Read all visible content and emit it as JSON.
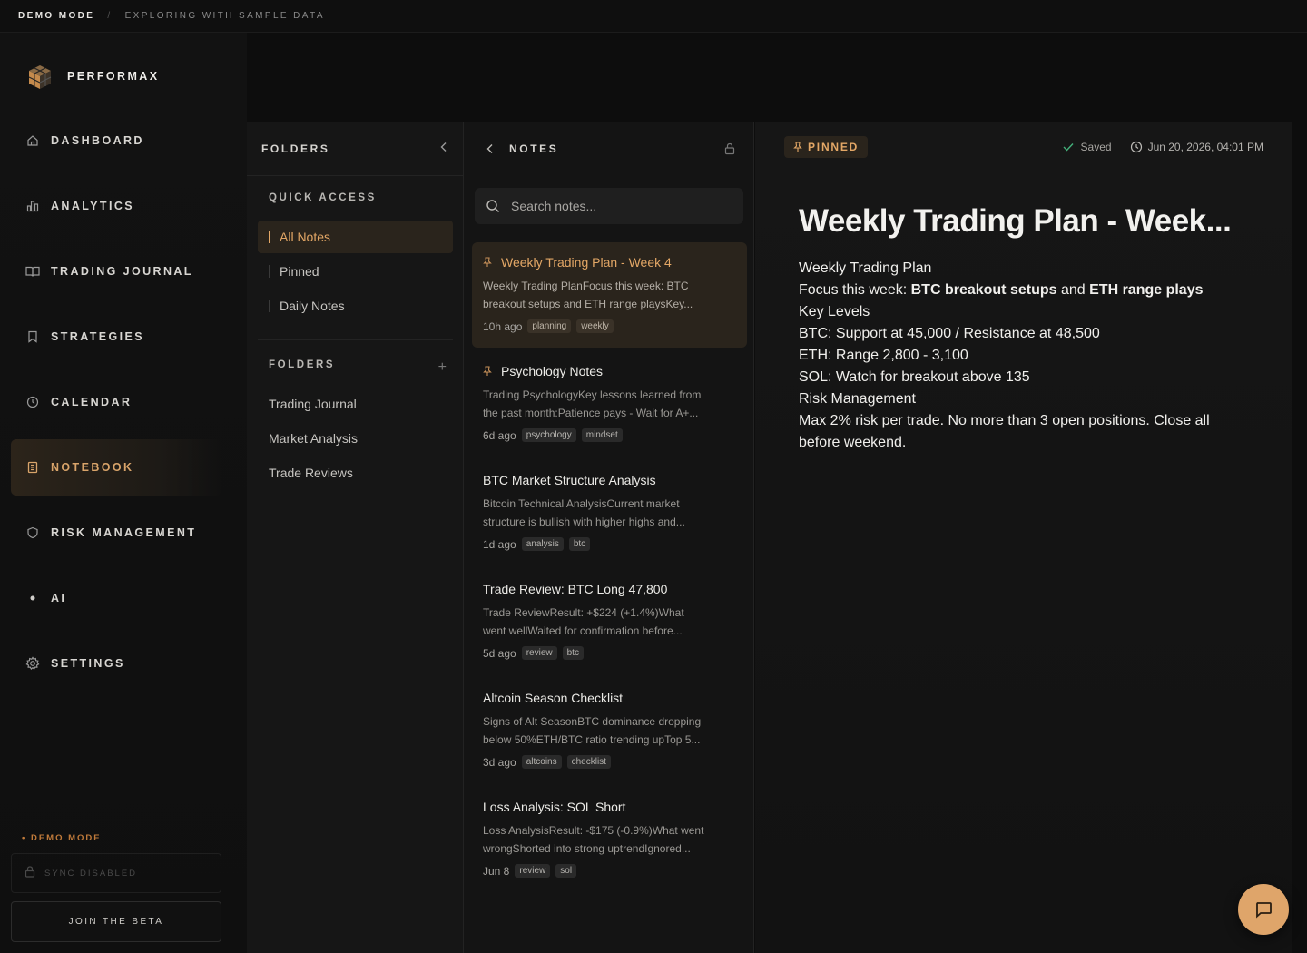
{
  "demo_bar": {
    "mode": "DEMO MODE",
    "separator": "/",
    "description": "EXPLORING WITH SAMPLE DATA"
  },
  "brand": {
    "name": "PERFORMAX"
  },
  "nav": [
    {
      "label": "DASHBOARD",
      "icon": "home-icon"
    },
    {
      "label": "ANALYTICS",
      "icon": "bar-chart-icon"
    },
    {
      "label": "TRADING JOURNAL",
      "icon": "book-open-icon"
    },
    {
      "label": "STRATEGIES",
      "icon": "bookmark-icon"
    },
    {
      "label": "CALENDAR",
      "icon": "clock-icon"
    },
    {
      "label": "NOTEBOOK",
      "icon": "notebook-icon",
      "active": true
    },
    {
      "label": "RISK MANAGEMENT",
      "icon": "shield-icon"
    },
    {
      "label": "AI",
      "icon": "dot-icon"
    },
    {
      "label": "SETTINGS",
      "icon": "gear-icon"
    }
  ],
  "sidebar_footer": {
    "demo_mode": "• DEMO MODE",
    "sync": "SYNC DISABLED",
    "join_beta": "JOIN THE BETA"
  },
  "folders_panel": {
    "title": "FOLDERS",
    "quick_access_title": "QUICK ACCESS",
    "quick_access": [
      {
        "label": "All Notes",
        "active": true
      },
      {
        "label": "Pinned"
      },
      {
        "label": "Daily Notes"
      }
    ],
    "folders_title": "FOLDERS",
    "folders": [
      "Trading Journal",
      "Market Analysis",
      "Trade Reviews"
    ]
  },
  "notes_panel": {
    "title": "NOTES",
    "search_placeholder": "Search notes...",
    "notes": [
      {
        "title": "Weekly Trading Plan - Week 4",
        "preview": "Weekly Trading PlanFocus this week: BTC breakout setups and ETH range playsKey...",
        "time": "10h ago",
        "tags": [
          "planning",
          "weekly"
        ],
        "pinned": true,
        "active": true
      },
      {
        "title": "Psychology Notes",
        "preview": "Trading PsychologyKey lessons learned from the past month:Patience pays - Wait for A+...",
        "time": "6d ago",
        "tags": [
          "psychology",
          "mindset"
        ],
        "pinned": true
      },
      {
        "title": "BTC Market Structure Analysis",
        "preview": "Bitcoin Technical AnalysisCurrent market structure is bullish with higher highs and...",
        "time": "1d ago",
        "tags": [
          "analysis",
          "btc"
        ]
      },
      {
        "title": "Trade Review: BTC Long 47,800",
        "preview": "Trade ReviewResult: +$224 (+1.4%)What went wellWaited for confirmation before...",
        "time": "5d ago",
        "tags": [
          "review",
          "btc"
        ]
      },
      {
        "title": "Altcoin Season Checklist",
        "preview": "Signs of Alt SeasonBTC dominance dropping below 50%ETH/BTC ratio trending upTop 5...",
        "time": "3d ago",
        "tags": [
          "altcoins",
          "checklist"
        ]
      },
      {
        "title": "Loss Analysis: SOL Short",
        "preview": "Loss AnalysisResult: -$175 (-0.9%)What went wrongShorted into strong uptrendIgnored...",
        "time": "Jun 8",
        "tags": [
          "review",
          "sol"
        ]
      }
    ]
  },
  "editor": {
    "pinned_label": "PINNED",
    "saved_label": "Saved",
    "timestamp": "Jun 20, 2026, 04:01 PM",
    "title": "Weekly Trading Plan - Week...",
    "body": {
      "h1": "Weekly Trading Plan",
      "focus_prefix": "Focus this week: ",
      "focus_a": "BTC breakout setups",
      "focus_and": " and ",
      "focus_b": "ETH range plays",
      "key_levels": "Key Levels",
      "btc": "BTC: Support at 45,000 / Resistance at 48,500",
      "eth": "ETH: Range 2,800 - 3,100",
      "sol": "SOL: Watch for breakout above 135",
      "risk_title": "Risk Management",
      "risk_text": "Max 2% risk per trade. No more than 3 open positions. Close all before weekend."
    }
  },
  "colors": {
    "accent": "#e3a766",
    "saved_check": "#43b07a",
    "background": "#0d0d0d"
  }
}
